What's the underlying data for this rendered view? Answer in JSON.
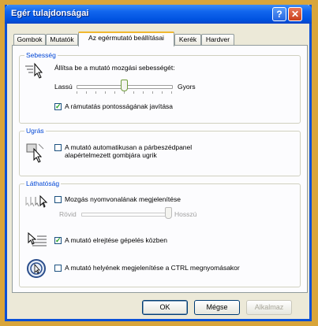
{
  "window": {
    "title": "Egér tulajdonságai"
  },
  "tabs": [
    {
      "label": "Gombok"
    },
    {
      "label": "Mutatók"
    },
    {
      "label": "Az egérmutató beállításai"
    },
    {
      "label": "Kerék"
    },
    {
      "label": "Hardver"
    }
  ],
  "speed": {
    "group_title": "Sebesség",
    "instruction": "Állítsa be a mutató mozgási sebességét:",
    "slow_label": "Lassú",
    "fast_label": "Gyors",
    "slider_fraction": 0.5,
    "precision_label": "A rámutatás pontosságának javítása",
    "precision_checked": true
  },
  "snap": {
    "group_title": "Ugrás",
    "label_line1": "A mutató automatikusan a párbeszédpanel",
    "label_line2": "alapértelmezett gombjára ugrik",
    "checked": false
  },
  "visibility": {
    "group_title": "Láthatóság",
    "trails_label": "Mozgás nyomvonalának megjelenítése",
    "trails_checked": false,
    "short_label": "Rövid",
    "long_label": "Hosszú",
    "trails_fraction": 1.0,
    "hide_label": "A mutató elrejtése gépelés közben",
    "hide_checked": true,
    "ctrl_label": "A mutató helyének megjelenítése a CTRL megnyomásakor",
    "ctrl_checked": false
  },
  "buttons": {
    "ok": "OK",
    "cancel": "Mégse",
    "apply": "Alkalmaz"
  },
  "icons": {
    "close": "close-icon",
    "help": "help-icon"
  }
}
